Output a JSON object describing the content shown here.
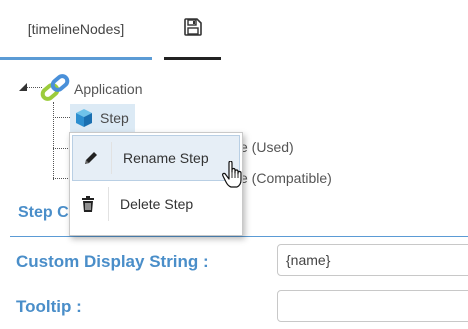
{
  "tabs": {
    "active_label": "[timelineNodes]",
    "save_icon": "save-icon"
  },
  "tree": {
    "root_label": "Application",
    "step_label": "Step",
    "partial_used": "e (Used)",
    "partial_compatible": "e (Compatible)"
  },
  "section": {
    "title": "Step C"
  },
  "form": {
    "display_label": "Custom Display String :",
    "display_value": "{name}",
    "tooltip_label": "Tooltip :",
    "tooltip_value": ""
  },
  "context_menu": {
    "rename_label": "Rename Step",
    "delete_label": "Delete Step"
  },
  "colors": {
    "accent": "#5b9bd5",
    "label_blue": "#4a8ec9",
    "selected_bg": "#dceaf5"
  }
}
